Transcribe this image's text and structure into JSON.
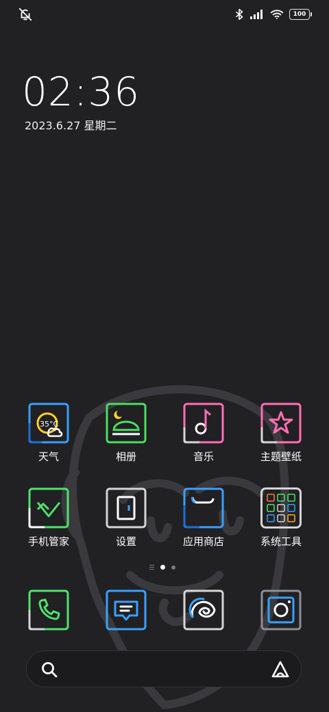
{
  "status_bar": {
    "left_icon": "bell-muted-icon",
    "bluetooth_icon": "bluetooth-icon",
    "signal_icon": "signal-bars-icon",
    "wifi_icon": "wifi-icon",
    "battery_level": "100"
  },
  "clock": {
    "time": "02:36",
    "date": "2023.6.27 星期二"
  },
  "apps_row1": [
    {
      "label": "天气",
      "icon": "weather-icon",
      "temp": "35°C",
      "color": "#3aa0ff"
    },
    {
      "label": "相册",
      "icon": "gallery-icon",
      "color": "#48e060"
    },
    {
      "label": "音乐",
      "icon": "music-icon",
      "color": "#ff6fb5"
    },
    {
      "label": "主题壁纸",
      "icon": "theme-star-icon",
      "color": "#ff6fb5"
    }
  ],
  "apps_row2": [
    {
      "label": "手机管家",
      "icon": "security-icon",
      "color": "#4ee46a"
    },
    {
      "label": "设置",
      "icon": "settings-icon",
      "color": "#d6d6d6"
    },
    {
      "label": "应用商店",
      "icon": "app-store-icon",
      "color": "#3aa0ff"
    },
    {
      "label": "系统工具",
      "icon": "folder-icon",
      "color": "#d6d6d6"
    }
  ],
  "page_indicator": {
    "pages": 2,
    "current": 1
  },
  "dock": [
    {
      "icon": "phone-icon",
      "color": "#4ee46a"
    },
    {
      "icon": "messages-icon",
      "color": "#3aa0ff"
    },
    {
      "icon": "browser-icon",
      "color": "#d6d6d6"
    },
    {
      "icon": "camera-icon",
      "color": "#8a9098"
    }
  ],
  "search": {
    "icon": "search-icon",
    "assistant_icon": "assistant-icon"
  }
}
